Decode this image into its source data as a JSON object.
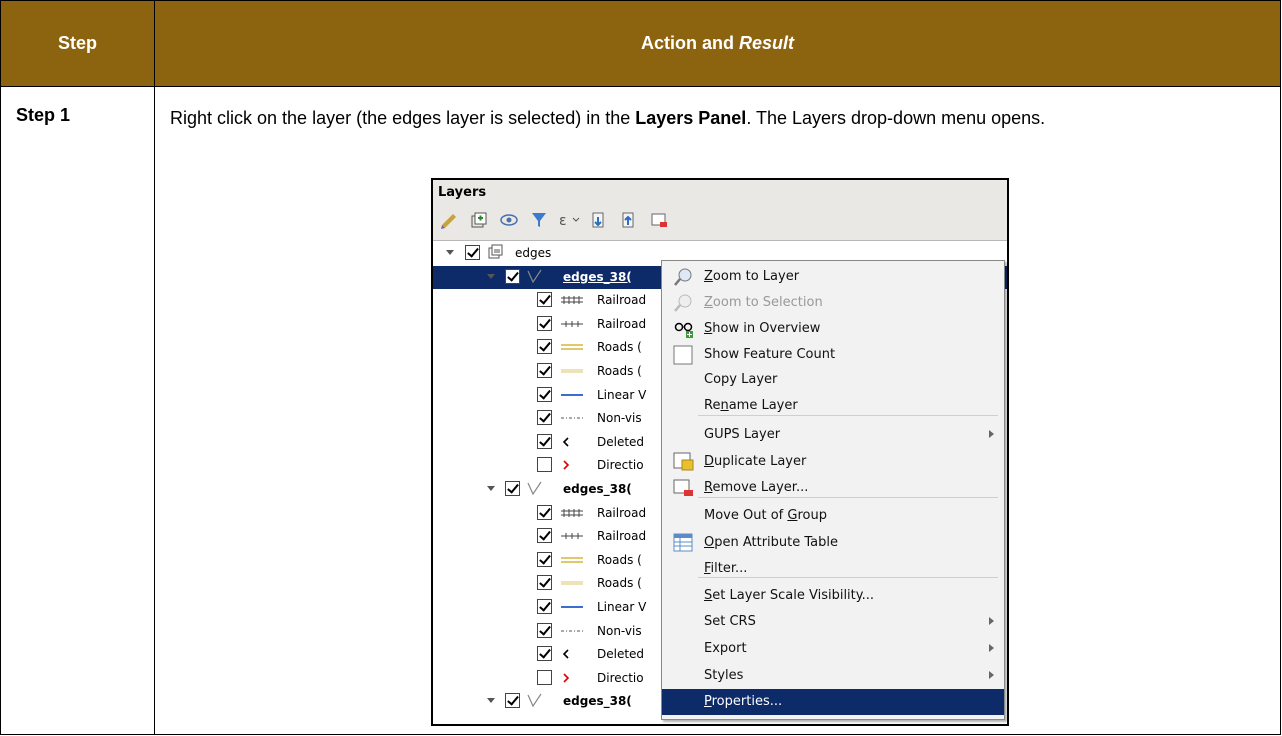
{
  "table": {
    "header_step": "Step",
    "header_action": "Action and ",
    "header_result": "Result",
    "step_label": "Step 1",
    "text_part1": "Right click on the layer (the edges layer is selected) in the ",
    "text_bold": "Layers Panel",
    "text_part2": ". The Layers drop-down menu opens."
  },
  "panel": {
    "title": "Layers",
    "rows": [
      {
        "label": "edges",
        "checked": true,
        "kind": "group"
      },
      {
        "label": "edges_38(",
        "checked": true,
        "kind": "layer-selected"
      },
      {
        "label": "Railroad",
        "checked": true,
        "kind": "railroad"
      },
      {
        "label": "Railroad",
        "checked": true,
        "kind": "railroad2"
      },
      {
        "label": "Roads (",
        "checked": true,
        "kind": "roads"
      },
      {
        "label": "Roads (",
        "checked": true,
        "kind": "roads2"
      },
      {
        "label": "Linear V",
        "checked": true,
        "kind": "linear"
      },
      {
        "label": "Non-vis",
        "checked": true,
        "kind": "nonvis"
      },
      {
        "label": "Deleted",
        "checked": true,
        "kind": "deleted"
      },
      {
        "label": "Directio",
        "checked": false,
        "kind": "direction"
      },
      {
        "label": "edges_38(",
        "checked": true,
        "kind": "layer"
      },
      {
        "label": "Railroad",
        "checked": true,
        "kind": "railroad"
      },
      {
        "label": "Railroad",
        "checked": true,
        "kind": "railroad2"
      },
      {
        "label": "Roads (",
        "checked": true,
        "kind": "roads"
      },
      {
        "label": "Roads (",
        "checked": true,
        "kind": "roads2"
      },
      {
        "label": "Linear V",
        "checked": true,
        "kind": "linear"
      },
      {
        "label": "Non-vis",
        "checked": true,
        "kind": "nonvis"
      },
      {
        "label": "Deleted",
        "checked": true,
        "kind": "deleted"
      },
      {
        "label": "Directio",
        "checked": false,
        "kind": "direction"
      },
      {
        "label": "edges_38(",
        "checked": true,
        "kind": "layer"
      }
    ]
  },
  "menu": {
    "items": [
      {
        "label": "Zoom to Layer",
        "mn": "Z",
        "icon": "zoom-layer-icon"
      },
      {
        "label": "Zoom to Selection",
        "mn": "Z",
        "icon": "zoom-selection-icon",
        "disabled": true
      },
      {
        "label": "Show in Overview",
        "mn": "S",
        "icon": "overview-icon"
      },
      {
        "label": "Show Feature Count",
        "icon": "checkbox-icon"
      },
      {
        "label": "Copy Layer"
      },
      {
        "label": "Rename Layer",
        "mn": "n"
      },
      {
        "label": "GUPS Layer",
        "submenu": true
      },
      {
        "label": "Duplicate Layer",
        "mn": "D",
        "icon": "duplicate-icon"
      },
      {
        "label": "Remove Layer...",
        "mn": "R",
        "icon": "remove-icon"
      },
      {
        "label": "Move Out of Group",
        "mn": "G"
      },
      {
        "label": "Open Attribute Table",
        "mn": "O",
        "icon": "table-icon"
      },
      {
        "label": "Filter...",
        "mn": "F"
      },
      {
        "label": "Set Layer Scale Visibility...",
        "mn": "S"
      },
      {
        "label": "Set CRS",
        "submenu": true
      },
      {
        "label": "Export",
        "submenu": true
      },
      {
        "label": "Styles",
        "submenu": true
      },
      {
        "label": "Properties...",
        "mn": "P",
        "highlighted": true
      }
    ]
  },
  "colors": {
    "header_bg": "#8c6410",
    "selection": "#0d2a69"
  }
}
